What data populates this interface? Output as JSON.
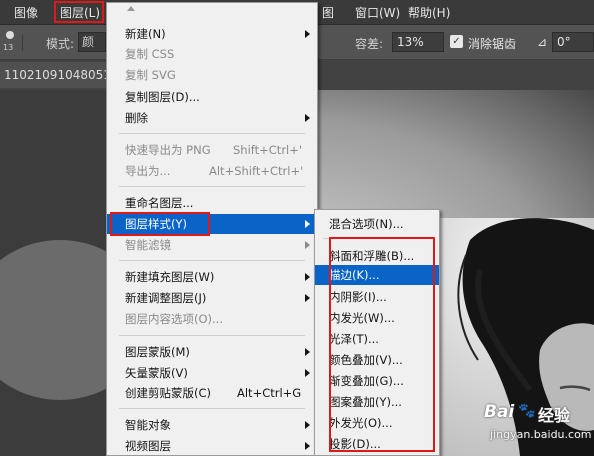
{
  "menubar": {
    "items": [
      "图像",
      "图层(L)",
      "图",
      "窗口(W)",
      "帮助(H)"
    ]
  },
  "options": {
    "mode_label": "模式:",
    "mode_value": "颜",
    "tolerance_label": "容差:",
    "tolerance_value": "13%",
    "antialias_label": "消除锯齿",
    "angle_value": "0°",
    "brush_size": "13"
  },
  "document": {
    "tab_title": "11021091048051.jpg"
  },
  "layer_menu": {
    "items": [
      {
        "label": "新建(N)",
        "shortcut": "",
        "submenu": true,
        "disabled": false
      },
      {
        "label": "复制 CSS",
        "shortcut": "",
        "submenu": false,
        "disabled": true
      },
      {
        "label": "复制 SVG",
        "shortcut": "",
        "submenu": false,
        "disabled": true
      },
      {
        "label": "复制图层(D)...",
        "shortcut": "",
        "submenu": false,
        "disabled": false
      },
      {
        "label": "删除",
        "shortcut": "",
        "submenu": true,
        "disabled": false
      },
      {
        "label": "快速导出为 PNG",
        "shortcut": "Shift+Ctrl+'",
        "submenu": false,
        "disabled": true
      },
      {
        "label": "导出为...",
        "shortcut": "Alt+Shift+Ctrl+'",
        "submenu": false,
        "disabled": true
      },
      {
        "label": "重命名图层...",
        "shortcut": "",
        "submenu": false,
        "disabled": false
      },
      {
        "label": "图层样式(Y)",
        "shortcut": "",
        "submenu": true,
        "disabled": false,
        "highlighted": true
      },
      {
        "label": "智能滤镜",
        "shortcut": "",
        "submenu": true,
        "disabled": true
      },
      {
        "label": "新建填充图层(W)",
        "shortcut": "",
        "submenu": true,
        "disabled": false
      },
      {
        "label": "新建调整图层(J)",
        "shortcut": "",
        "submenu": true,
        "disabled": false
      },
      {
        "label": "图层内容选项(O)...",
        "shortcut": "",
        "submenu": false,
        "disabled": true
      },
      {
        "label": "图层蒙版(M)",
        "shortcut": "",
        "submenu": true,
        "disabled": false
      },
      {
        "label": "矢量蒙版(V)",
        "shortcut": "",
        "submenu": true,
        "disabled": false
      },
      {
        "label": "创建剪贴蒙版(C)",
        "shortcut": "Alt+Ctrl+G",
        "submenu": false,
        "disabled": false
      },
      {
        "label": "智能对象",
        "shortcut": "",
        "submenu": true,
        "disabled": false
      },
      {
        "label": "视频图层",
        "shortcut": "",
        "submenu": true,
        "disabled": false
      }
    ]
  },
  "style_submenu": {
    "items": [
      {
        "label": "混合选项(N)...",
        "highlighted": false
      },
      {
        "label": "斜面和浮雕(B)...",
        "highlighted": false
      },
      {
        "label": "描边(K)...",
        "highlighted": true
      },
      {
        "label": "内阴影(I)...",
        "highlighted": false
      },
      {
        "label": "内发光(W)...",
        "highlighted": false
      },
      {
        "label": "光泽(T)...",
        "highlighted": false
      },
      {
        "label": "颜色叠加(V)...",
        "highlighted": false
      },
      {
        "label": "渐变叠加(G)...",
        "highlighted": false
      },
      {
        "label": "图案叠加(Y)...",
        "highlighted": false
      },
      {
        "label": "外发光(O)...",
        "highlighted": false
      },
      {
        "label": "投影(D)...",
        "highlighted": false
      }
    ]
  },
  "watermark": {
    "brand": "Bai",
    "brand2": "经验",
    "url": "jingyan.baidu.com"
  },
  "colors": {
    "highlight": "#0a64c8",
    "annotation_red": "#e01818"
  }
}
